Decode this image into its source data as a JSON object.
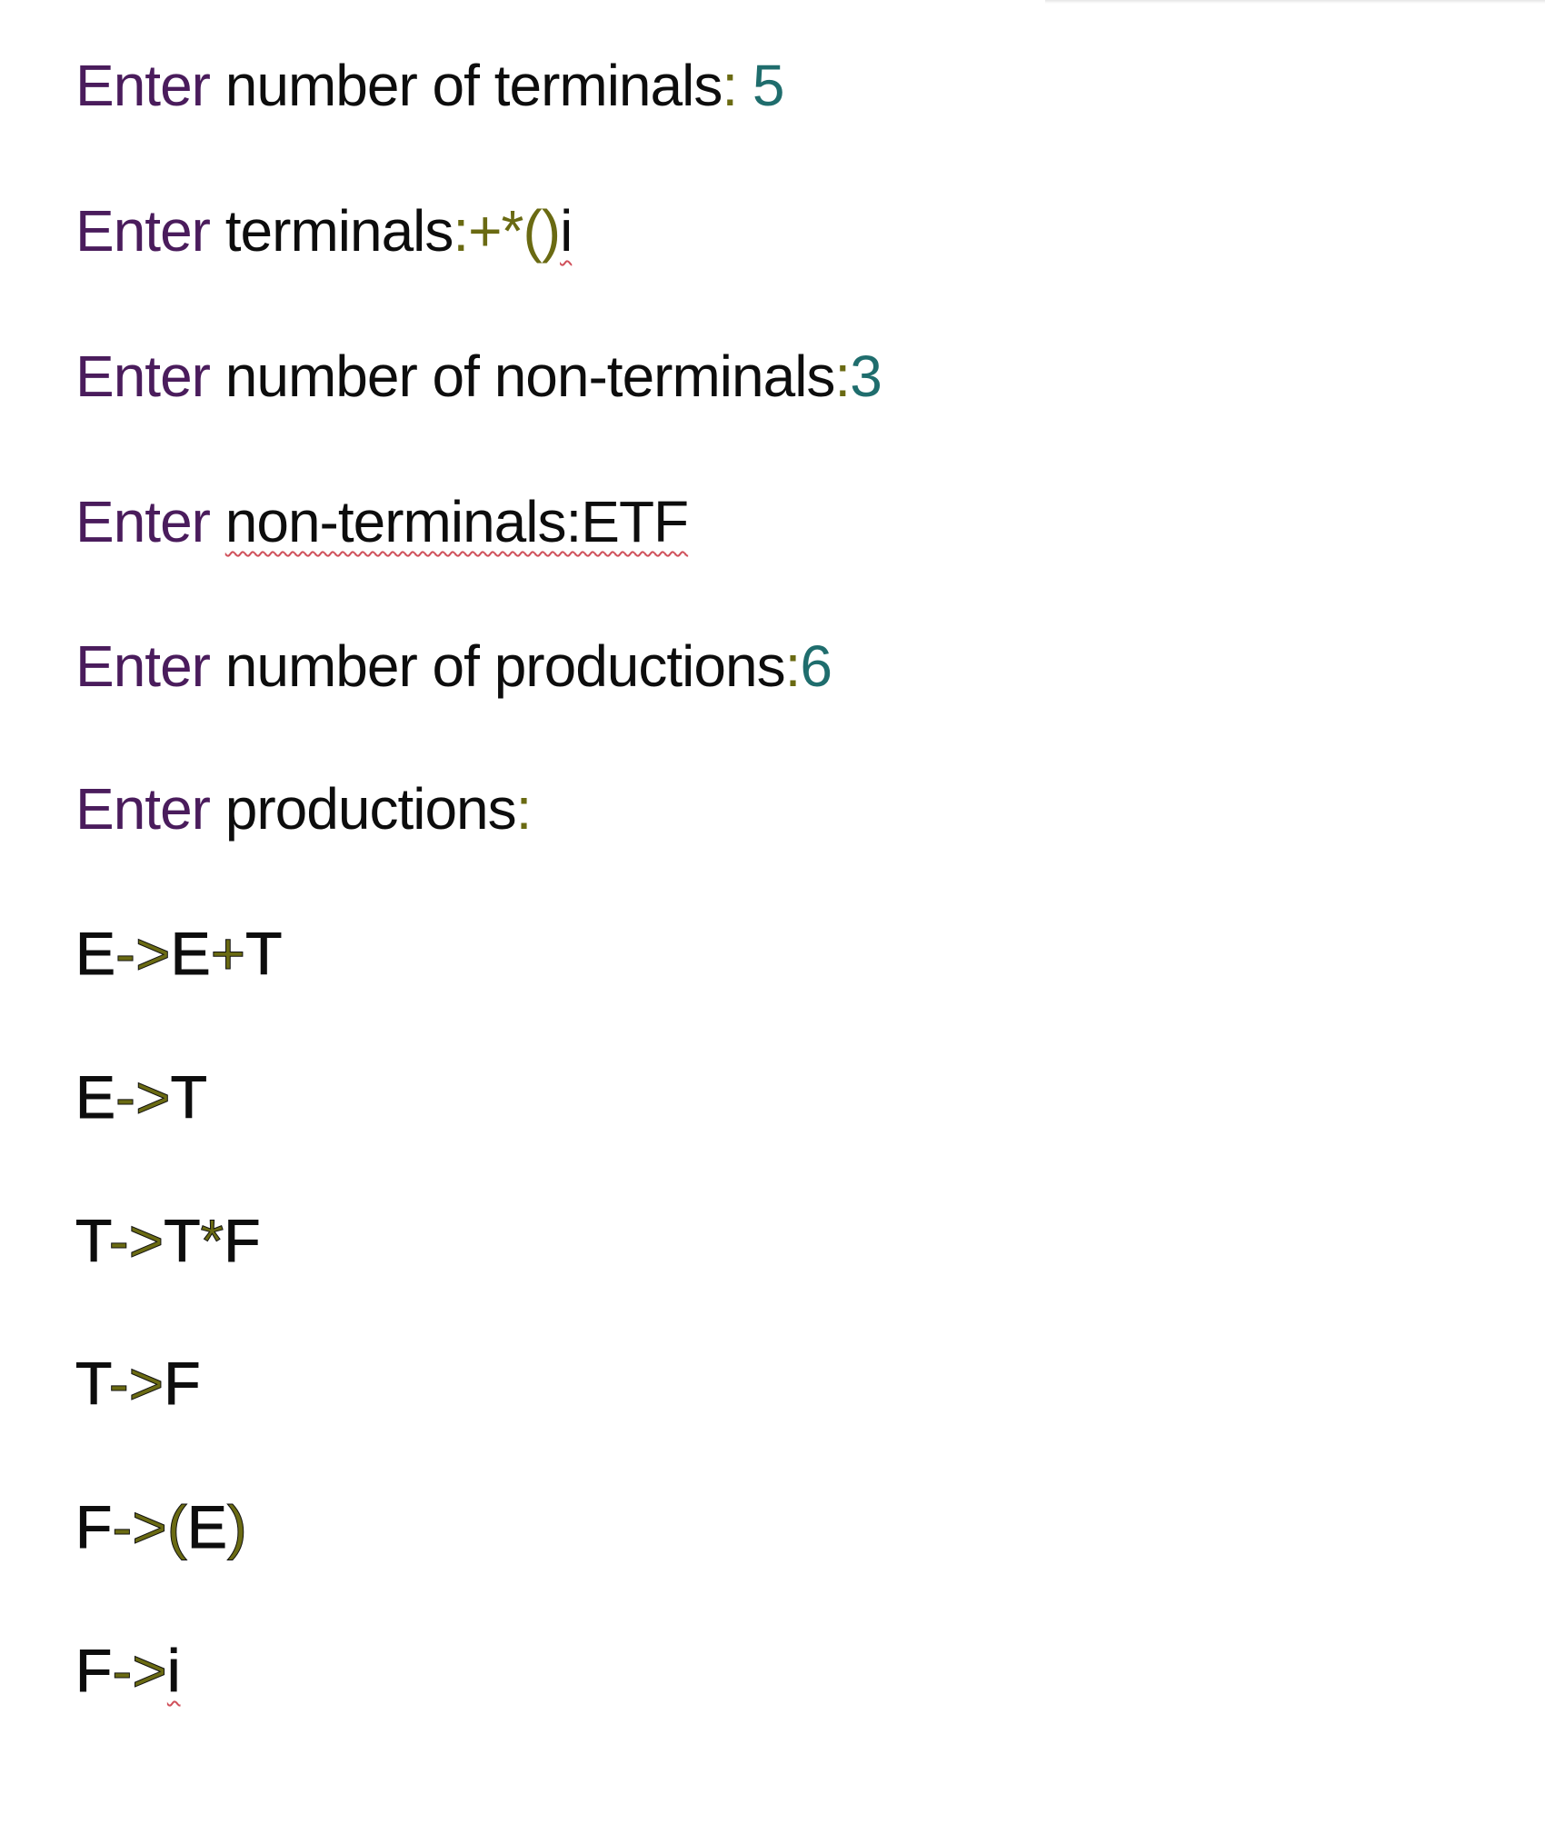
{
  "colors": {
    "prompt": "#4a1c5c",
    "text": "#0d0d0d",
    "symbol": "#6a6a12",
    "number": "#1f6d6d",
    "spellcheck": "#d0505a"
  },
  "lines": [
    {
      "segments": [
        {
          "text": "Enter",
          "c": "purple"
        },
        {
          "text": " number of terminals",
          "c": "black"
        },
        {
          "text": ":",
          "c": "olive"
        },
        {
          "text": " 5",
          "c": "teal"
        }
      ]
    },
    {
      "segments": [
        {
          "text": "Enter",
          "c": "purple"
        },
        {
          "text": " terminals",
          "c": "black"
        },
        {
          "text": ":+*()",
          "c": "olive"
        },
        {
          "text": "i",
          "c": "black",
          "squiggle": true
        }
      ]
    },
    {
      "segments": [
        {
          "text": "Enter",
          "c": "purple"
        },
        {
          "text": " number of non-terminals",
          "c": "black"
        },
        {
          "text": ":",
          "c": "olive"
        },
        {
          "text": "3",
          "c": "teal"
        }
      ]
    },
    {
      "segments": [
        {
          "text": "Enter",
          "c": "purple"
        },
        {
          "text": " ",
          "c": "black"
        },
        {
          "text": "non-terminals:ETF",
          "c": "black",
          "squiggle": true
        }
      ]
    },
    {
      "segments": [
        {
          "text": "Enter",
          "c": "purple"
        },
        {
          "text": " number of productions",
          "c": "black"
        },
        {
          "text": ":",
          "c": "olive"
        },
        {
          "text": "6",
          "c": "teal"
        }
      ]
    },
    {
      "segments": [
        {
          "text": "Enter",
          "c": "purple"
        },
        {
          "text": " productions",
          "c": "black"
        },
        {
          "text": ":",
          "c": "olive"
        }
      ]
    },
    {
      "prod": true,
      "segments": [
        {
          "text": "E",
          "c": "black"
        },
        {
          "text": "->",
          "c": "olive"
        },
        {
          "text": "E",
          "c": "black"
        },
        {
          "text": "+",
          "c": "olive"
        },
        {
          "text": "T",
          "c": "black"
        }
      ]
    },
    {
      "prod": true,
      "segments": [
        {
          "text": "E",
          "c": "black"
        },
        {
          "text": "->",
          "c": "olive"
        },
        {
          "text": "T",
          "c": "black"
        }
      ]
    },
    {
      "prod": true,
      "segments": [
        {
          "text": "T",
          "c": "black"
        },
        {
          "text": "->",
          "c": "olive"
        },
        {
          "text": "T",
          "c": "black"
        },
        {
          "text": "*",
          "c": "olive"
        },
        {
          "text": "F",
          "c": "black"
        }
      ]
    },
    {
      "prod": true,
      "segments": [
        {
          "text": "T",
          "c": "black"
        },
        {
          "text": "->",
          "c": "olive"
        },
        {
          "text": "F",
          "c": "black"
        }
      ]
    },
    {
      "prod": true,
      "segments": [
        {
          "text": "F",
          "c": "black"
        },
        {
          "text": "->(",
          "c": "olive"
        },
        {
          "text": "E",
          "c": "black"
        },
        {
          "text": ")",
          "c": "olive"
        }
      ]
    },
    {
      "prod": true,
      "segments": [
        {
          "text": "F",
          "c": "black"
        },
        {
          "text": "->",
          "c": "olive"
        },
        {
          "text": "i",
          "c": "black",
          "squiggle": true
        }
      ]
    }
  ]
}
